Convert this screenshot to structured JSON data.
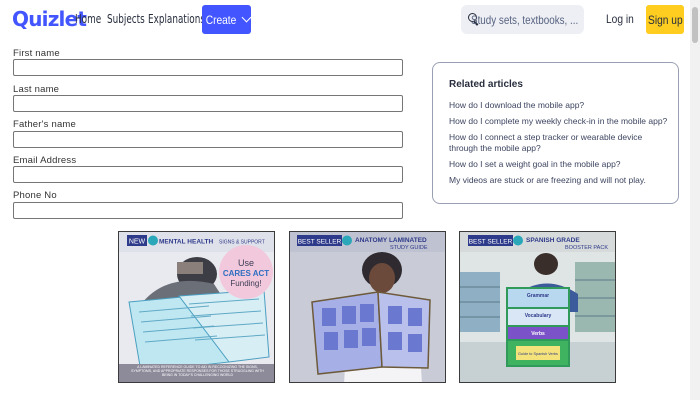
{
  "header": {
    "logo": "Quizlet",
    "nav": [
      "Home",
      "Subjects",
      "Explanations"
    ],
    "create_label": "Create",
    "search_placeholder": "Study sets, textbooks, ...",
    "login_label": "Log in",
    "signup_label": "Sign up"
  },
  "form": {
    "fields": [
      {
        "label": "First name",
        "value": ""
      },
      {
        "label": "Last name",
        "value": ""
      },
      {
        "label": "Father's name",
        "value": ""
      },
      {
        "label": "Email Address",
        "value": ""
      },
      {
        "label": "Phone No",
        "value": ""
      }
    ]
  },
  "related": {
    "title": "Related articles",
    "articles": [
      "How do I download the mobile app?",
      "How do I complete my weekly check-in in the mobile app?",
      "How do I connect a step tracker or wearable device through the mobile app?",
      "How do I set a weight goal in the mobile app?",
      "My videos are stuck or are freezing and will not play."
    ]
  },
  "ads": [
    {
      "badge": "NEW",
      "title": "MENTAL HEALTH",
      "subtitle": "SIGNS & SUPPORT",
      "bubble_lines": [
        "Use",
        "CARES ACT",
        "Funding!"
      ],
      "caption": "A LAMINATED REFERENCE GUIDE TO AID IN RECOGNIZING THE SIGNS, SYMPTOMS, AND APPROPRIATE RESPONSES FOR THOSE STRUGGLING WITH BEING IN TODAY'S CHALLENGING WORLD"
    },
    {
      "badge": "BEST SELLER",
      "title": "ANATOMY LAMINATED",
      "subtitle": "STUDY GUIDE"
    },
    {
      "badge": "BEST SELLER",
      "title": "SPANISH GRADE",
      "subtitle": "BOOSTER PACK",
      "chart_labels": [
        "Grammar",
        "Vocabulary",
        "Verbs",
        "Guide to Spanish Verbs"
      ]
    }
  ],
  "colors": {
    "brand": "#4255ff",
    "signup": "#ffcd1f",
    "text": "#282e3e",
    "ad_badge": "#2e3a8a"
  }
}
